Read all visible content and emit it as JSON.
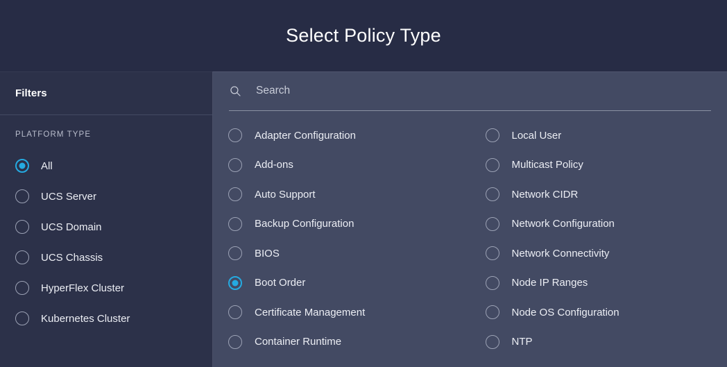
{
  "header": {
    "title": "Select Policy Type"
  },
  "sidebar": {
    "title": "Filters",
    "section_label": "PLATFORM TYPE",
    "selected": "All",
    "items": [
      {
        "label": "All",
        "checked": true
      },
      {
        "label": "UCS Server",
        "checked": false
      },
      {
        "label": "UCS Domain",
        "checked": false
      },
      {
        "label": "UCS Chassis",
        "checked": false
      },
      {
        "label": "HyperFlex Cluster",
        "checked": false
      },
      {
        "label": "Kubernetes Cluster",
        "checked": false
      }
    ]
  },
  "search": {
    "icon": "search-icon",
    "placeholder": "Search",
    "value": ""
  },
  "policies": {
    "selected": "Boot Order",
    "left_column": [
      {
        "label": "Adapter Configuration",
        "checked": false
      },
      {
        "label": "Add-ons",
        "checked": false
      },
      {
        "label": "Auto Support",
        "checked": false
      },
      {
        "label": "Backup Configuration",
        "checked": false
      },
      {
        "label": "BIOS",
        "checked": false
      },
      {
        "label": "Boot Order",
        "checked": true
      },
      {
        "label": "Certificate Management",
        "checked": false
      },
      {
        "label": "Container Runtime",
        "checked": false
      }
    ],
    "right_column": [
      {
        "label": "Local User",
        "checked": false
      },
      {
        "label": "Multicast Policy",
        "checked": false
      },
      {
        "label": "Network CIDR",
        "checked": false
      },
      {
        "label": "Network Configuration",
        "checked": false
      },
      {
        "label": "Network Connectivity",
        "checked": false
      },
      {
        "label": "Node IP Ranges",
        "checked": false
      },
      {
        "label": "Node OS Configuration",
        "checked": false
      },
      {
        "label": "NTP",
        "checked": false
      }
    ]
  },
  "colors": {
    "header_bg": "#272c45",
    "sidebar_bg": "#2c3149",
    "main_bg": "#434a63",
    "accent": "#25aae1",
    "text": "#eceef4",
    "muted_text": "#b9bdcc"
  }
}
